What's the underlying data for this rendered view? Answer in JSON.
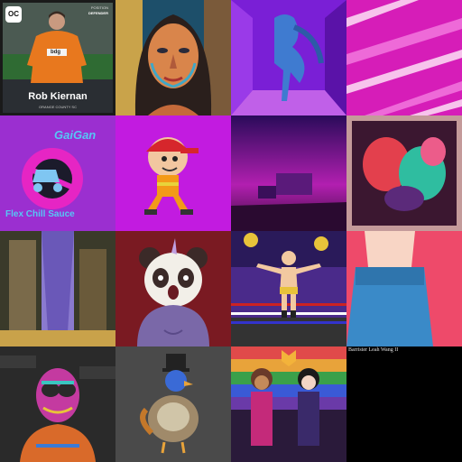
{
  "gallery": {
    "card": {
      "player_name": "Rob Kiernan",
      "team": "ORANGE COUNTY SC",
      "position_label": "POSITION",
      "position": "DEFENDER",
      "badge": "OC",
      "sponsor": "bdg"
    },
    "logo_tile": {
      "brand_top": "GaiGan",
      "brand_bottom": "Flex Chill Sauce"
    },
    "caption_tile": {
      "title": "Barrister Leah Wang II"
    }
  }
}
